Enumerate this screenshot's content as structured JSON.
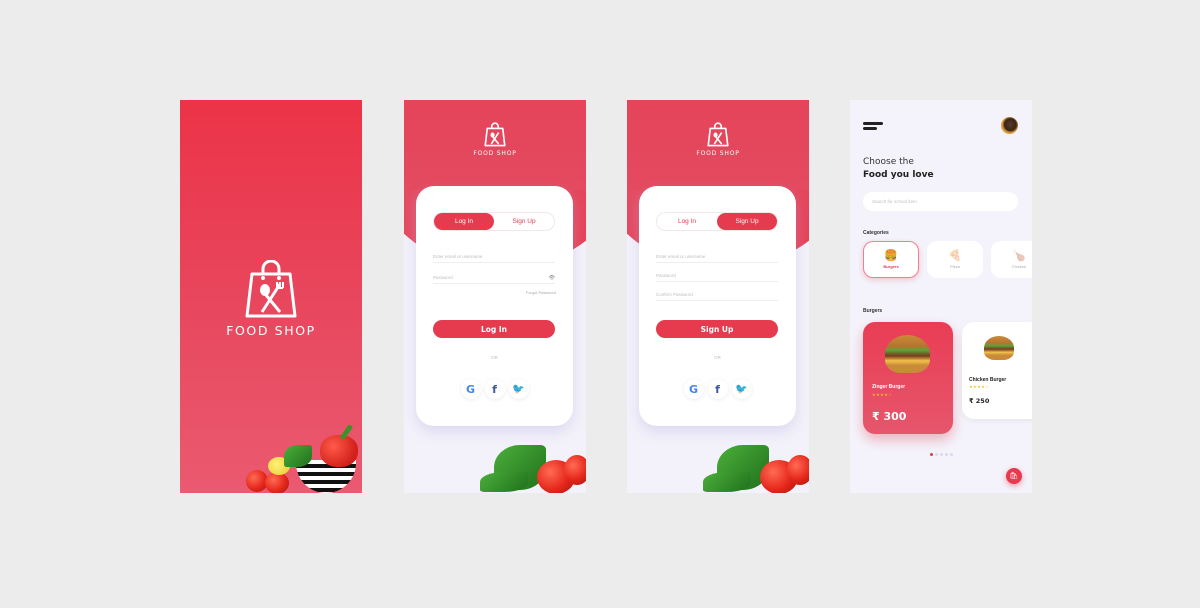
{
  "brand": {
    "name": "FOOD SHOP",
    "primary_color": "#e63a4e"
  },
  "splash": {
    "title": "FOOD SHOP"
  },
  "login": {
    "logo_text": "FOOD SHOP",
    "tabs": [
      {
        "label": "Log In",
        "active": true
      },
      {
        "label": "Sign Up",
        "active": false
      }
    ],
    "fields": [
      {
        "placeholder": "Enter email or username"
      },
      {
        "placeholder": "Password"
      }
    ],
    "eye_icon": "👁",
    "forgot_label": "Forgot Password",
    "submit_label": "Log In",
    "or_label": "OR",
    "socials": [
      "G",
      "f",
      "🐦"
    ]
  },
  "signup": {
    "logo_text": "FOOD SHOP",
    "tabs": [
      {
        "label": "Log In",
        "active": false
      },
      {
        "label": "Sign Up",
        "active": true
      }
    ],
    "fields": [
      {
        "placeholder": "Enter email or username"
      },
      {
        "placeholder": "Password"
      },
      {
        "placeholder": "Confirm Password"
      }
    ],
    "submit_label": "Sign Up",
    "or_label": "OR",
    "socials": [
      "G",
      "f",
      "🐦"
    ]
  },
  "home": {
    "greeting_line1": "Choose the",
    "greeting_line2": "Food you love",
    "search_placeholder": "Search for school item",
    "categories_label": "Categories",
    "categories": [
      {
        "label": "Burgers",
        "icon": "🍔",
        "active": true
      },
      {
        "label": "Pizza",
        "icon": "🍕",
        "active": false
      },
      {
        "label": "Chicken",
        "icon": "🍗",
        "active": false
      }
    ],
    "section_label": "Burgers",
    "foods": [
      {
        "name": "Zinger Burger",
        "stars": "★★★★☆",
        "rating": 4,
        "price": "₹ 300",
        "featured": true
      },
      {
        "name": "Chicken Burger",
        "stars": "★★★★☆",
        "rating": 4,
        "price": "₹ 250",
        "featured": false
      }
    ],
    "pager": {
      "pages": 5,
      "current": 1
    },
    "fab_icon": "🛍"
  }
}
